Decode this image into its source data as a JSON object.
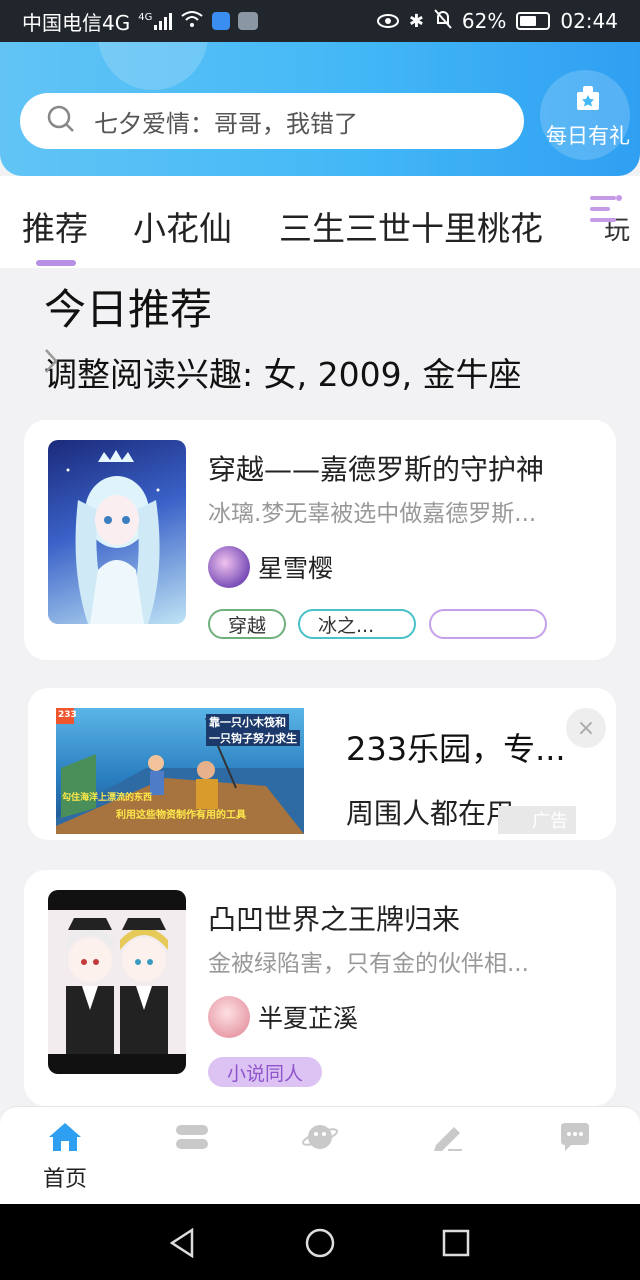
{
  "status_bar": {
    "carrier": "中国电信4G",
    "signal_tag": "4G",
    "battery": "62%",
    "time": "02:44"
  },
  "search": {
    "placeholder": "七夕爱情：哥哥，我错了"
  },
  "gift": {
    "label": "每日有礼"
  },
  "tabs": [
    {
      "label": "推荐",
      "active": true
    },
    {
      "label": "小花仙"
    },
    {
      "label": "三生三世十里桃花"
    },
    {
      "label": "玩"
    }
  ],
  "section": {
    "title": "今日推荐",
    "interest": "调整阅读兴趣: 女, 2009, 金牛座"
  },
  "books": [
    {
      "title": "穿越——嘉德罗斯的守护神",
      "desc": "冰璃.梦无辜被选中做嘉德罗斯...",
      "author": "星雪樱",
      "tags": [
        "穿越",
        "冰之..."
      ]
    },
    {
      "title": "凸凹世界之王牌归来",
      "desc": "金被绿陷害，只有金的伙伴相...",
      "author": "半夏芷溪",
      "tags": [
        "小说同人"
      ]
    }
  ],
  "ad": {
    "title": "233乐园，专...",
    "subtitle": "周围人都在用",
    "label": "广告",
    "close": "×",
    "image_badge": "233",
    "image_text_1": "靠一只小木筏和",
    "image_text_2": "一只钩子努力求生",
    "image_text_3": "勾住海洋上漂流的东西",
    "image_text_4": "利用这些物资制作有用的工具"
  },
  "bottom_nav": {
    "home_label": "首页"
  },
  "colors": {
    "accent": "#b790e6",
    "header": "#43b8f6",
    "home_icon": "#2f9ff2"
  }
}
